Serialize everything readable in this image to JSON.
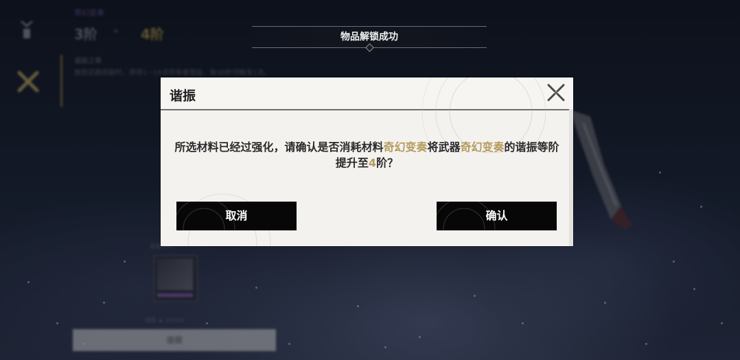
{
  "background": {
    "weapon_name": "奇幻变奏",
    "level_from": "3阶",
    "level_to": "4阶",
    "effect_title": "谐振之章",
    "effect_desc": "施放武器技能时，获得1~14点所有者增益，每30秒可触发1次。",
    "slot_label": "谐振材料",
    "cost_text": "消耗 ◈ 10000",
    "action_button": "谐振",
    "accent_color": "#b59c48",
    "rarity_color": "#8a5bb0"
  },
  "banner": {
    "text": "物品解锁成功"
  },
  "dialog": {
    "title": "谐振",
    "message": {
      "part1": "所选材料已经过强化，请确认是否消耗材料",
      "material_name": "奇幻变奏",
      "part2": "将武器",
      "weapon_name": "奇幻变奏",
      "part3": "的谐振等阶提升至",
      "target_level": "4",
      "part4": "阶？"
    },
    "highlight_color": "#b59a5b",
    "cancel_label": "取消",
    "confirm_label": "确认",
    "close_icon": "close-icon"
  }
}
